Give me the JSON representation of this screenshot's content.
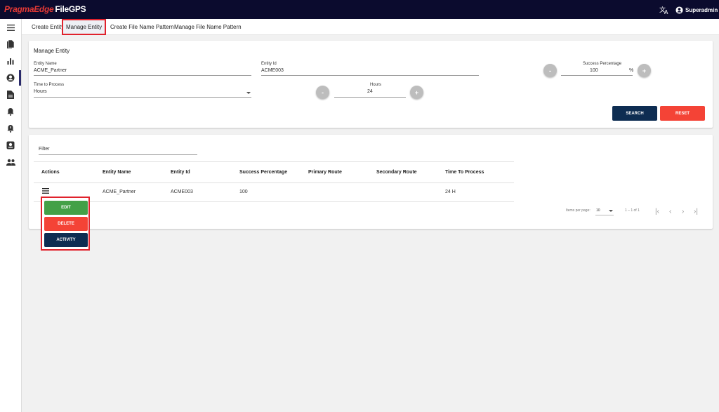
{
  "brand": {
    "part1": "PragmaEdge",
    "part2": "FileGPS"
  },
  "header": {
    "user_name": "Superadmin"
  },
  "tabs": [
    {
      "label": "Create Entity"
    },
    {
      "label": "Manage Entity"
    },
    {
      "label": "Create File Name Pattern"
    },
    {
      "label": "Manage File Name Pattern"
    }
  ],
  "form": {
    "title": "Manage Entity",
    "entity_name": {
      "label": "Entity Name",
      "value": "ACME_Partner"
    },
    "entity_id": {
      "label": "Entity Id",
      "value": "ACME003"
    },
    "success_percentage": {
      "label": "Success Percentage",
      "value": "100",
      "unit": "%"
    },
    "time_to_process": {
      "label": "Time to Process",
      "value": "Hours"
    },
    "hours": {
      "label": "Hours",
      "value": "24"
    },
    "minus": "-",
    "plus": "+",
    "search_label": "SEARCH",
    "reset_label": "RESET"
  },
  "table": {
    "filter_placeholder": "Filter",
    "headers": [
      "Actions",
      "Entity Name",
      "Entity Id",
      "Success Percentage",
      "Primary Route",
      "Secondary Route",
      "Time To Process"
    ],
    "rows": [
      {
        "entity_name": "ACME_Partner",
        "entity_id": "ACME003",
        "success_percentage": "100",
        "primary_route": "",
        "secondary_route": "",
        "time_to_process": "24 H"
      }
    ]
  },
  "paginator": {
    "items_per_page_label": "Items per page:",
    "page_size": "10",
    "range": "1 – 1 of 1"
  },
  "action_menu": {
    "edit": "EDIT",
    "delete": "DELETE",
    "activity": "ACTIVITY"
  },
  "colors": {
    "topbar": "#0b0b2e",
    "brand_red": "#e53935",
    "navy_button": "#0e2d52",
    "red_button": "#f44336",
    "green_button": "#43a047",
    "highlight": "#e0222c"
  }
}
